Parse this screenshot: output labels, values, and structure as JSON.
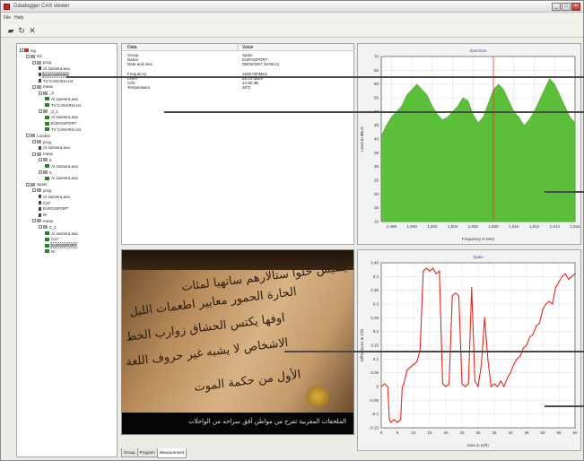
{
  "window": {
    "title": "Datalogger CAS viewer"
  },
  "menu": {
    "file": "File",
    "help": "Help"
  },
  "toolbar_icons": [
    "open-folder-icon",
    "refresh-icon",
    "close-x-icon"
  ],
  "tree": [
    {
      "label": "log",
      "depth": 0,
      "icon": "root"
    },
    {
      "label": "G1",
      "depth": 1,
      "icon": "folder"
    },
    {
      "label": "prog",
      "depth": 2,
      "icon": "folder"
    },
    {
      "label": "Al Jazeera.ava",
      "depth": 3,
      "icon": "doc"
    },
    {
      "label": "EUROSPORT",
      "depth": 3,
      "icon": "doc",
      "selected": true
    },
    {
      "label": "TV CANARIA.txt",
      "depth": 3,
      "icon": "doc"
    },
    {
      "label": "meas",
      "depth": 2,
      "icon": "folder"
    },
    {
      "label": "_0",
      "depth": 3,
      "icon": "folder"
    },
    {
      "label": "Al Jazeera.ava",
      "depth": 4,
      "icon": "meas"
    },
    {
      "label": "TV CANARIA.txt",
      "depth": 4,
      "icon": "meas"
    },
    {
      "label": "_0_1",
      "depth": 3,
      "icon": "folder"
    },
    {
      "label": "Al Jazeera.ava",
      "depth": 4,
      "icon": "meas"
    },
    {
      "label": "EUROSPORT",
      "depth": 4,
      "icon": "meas"
    },
    {
      "label": "TV CANARIA.txt",
      "depth": 4,
      "icon": "meas"
    },
    {
      "label": "London",
      "depth": 1,
      "icon": "folder"
    },
    {
      "label": "prog",
      "depth": 2,
      "icon": "folder"
    },
    {
      "label": "Al Jazeera.ava",
      "depth": 3,
      "icon": "doc"
    },
    {
      "label": "meas",
      "depth": 2,
      "icon": "folder"
    },
    {
      "label": "0",
      "depth": 3,
      "icon": "folder"
    },
    {
      "label": "Al Jazeera.ava",
      "depth": 4,
      "icon": "meas"
    },
    {
      "label": "0",
      "depth": 3,
      "icon": "folder"
    },
    {
      "label": "Al Jazeera.ava",
      "depth": 4,
      "icon": "meas"
    },
    {
      "label": "Spain",
      "depth": 1,
      "icon": "folder"
    },
    {
      "label": "prog",
      "depth": 2,
      "icon": "folder"
    },
    {
      "label": "Al Jazeera.ava",
      "depth": 3,
      "icon": "doc"
    },
    {
      "label": "C47",
      "depth": 3,
      "icon": "doc"
    },
    {
      "label": "EUROSPORT",
      "depth": 3,
      "icon": "doc"
    },
    {
      "label": "M",
      "depth": 3,
      "icon": "doc"
    },
    {
      "label": "meas",
      "depth": 2,
      "icon": "folder"
    },
    {
      "label": "0_1",
      "depth": 3,
      "icon": "folder"
    },
    {
      "label": "Al Jazeera.ava",
      "depth": 4,
      "icon": "meas"
    },
    {
      "label": "C47",
      "depth": 4,
      "icon": "meas"
    },
    {
      "label": "EUROSPORT",
      "depth": 4,
      "icon": "meas",
      "selected": true
    },
    {
      "label": "M",
      "depth": 4,
      "icon": "meas"
    }
  ],
  "properties": {
    "col_data": "Data",
    "col_value": "Value",
    "rows": [
      {
        "k": "Group",
        "v": "Spain"
      },
      {
        "k": "Name",
        "v": "EUROSPORT"
      },
      {
        "k": "Date and time",
        "v": "05/03/2007 16:08:21"
      },
      {
        "k": "",
        "v": ""
      },
      {
        "k": "Frequency",
        "v": "1508.000MHz"
      },
      {
        "k": "Level",
        "v": "55.00 dBuV"
      },
      {
        "k": "C/N",
        "v": "14.80 dB"
      },
      {
        "k": "Temperature",
        "v": "20ºC"
      }
    ]
  },
  "video": {
    "lines": [
      "يتقيس خلوا ستالارهم ساتهيا لمئات",
      "الحارة الحمور معايير اطعمات الليل",
      "اوفها يكتس الحشاق زوارب الخط",
      "الاشخاص لا يشبه غير حروف اللغة",
      "الأول من حكمة الموت"
    ],
    "caption": "الملحقات المغربية تفرح من مواطن أفق سراحه من الواحلات"
  },
  "tabs": [
    "Group",
    "Program",
    "Measurement"
  ],
  "active_tab": "Measurement",
  "colors": {
    "spectrum_fill": "#5cbf3a",
    "time_series": "#e8271e",
    "marker": "#e8271e",
    "grid": "#9ea7b0"
  },
  "chart_data": [
    {
      "type": "area",
      "title": "Spectrum",
      "xlabel": "Frequency in MHz",
      "ylabel": "Level in dBuV",
      "xlim": [
        1497,
        1516
      ],
      "ylim": [
        10,
        70
      ],
      "x_ticks": [
        1,
        498,
        1,
        500,
        1,
        502,
        1,
        504,
        1,
        506,
        1,
        508,
        1,
        510,
        1,
        512,
        1,
        514,
        1,
        516
      ],
      "x_tick_labels": [
        "1,498",
        "1,500",
        "1,502",
        "1,504",
        "1,506",
        "1,508",
        "1,510",
        "1,512",
        "1,514",
        "1,516"
      ],
      "y_ticks": [
        10,
        15,
        20,
        25,
        30,
        35,
        40,
        45,
        50,
        55,
        60,
        65,
        70
      ],
      "marker_x": 1508,
      "x": [
        1497.0,
        1497.5,
        1498.0,
        1498.5,
        1499.0,
        1499.5,
        1500.0,
        1500.5,
        1501.0,
        1501.5,
        1502.0,
        1502.5,
        1503.0,
        1503.5,
        1504.0,
        1504.5,
        1505.0,
        1505.5,
        1506.0,
        1506.5,
        1507.0,
        1507.5,
        1508.0,
        1508.5,
        1509.0,
        1509.5,
        1510.0,
        1510.5,
        1511.0,
        1511.5,
        1512.0,
        1512.5,
        1513.0,
        1513.5,
        1514.0,
        1514.5,
        1515.0,
        1515.5,
        1516.0
      ],
      "values": [
        41,
        45,
        48,
        50,
        52,
        56,
        58,
        60,
        58,
        56,
        52,
        49,
        47,
        48,
        50,
        52,
        55,
        54,
        49,
        46,
        48,
        53,
        58,
        60,
        58,
        54,
        50,
        48,
        45,
        47,
        50,
        54,
        58,
        62,
        60,
        56,
        52,
        48,
        46
      ]
    },
    {
      "type": "line",
      "title": "Spain",
      "xlabel": "time in (s/h)",
      "ylabel": "Differences in C/N",
      "xlim": [
        0,
        60
      ],
      "ylim": [
        -0.15,
        0.45
      ],
      "x_ticks": [
        0,
        5,
        10,
        15,
        20,
        25,
        30,
        35,
        40,
        45,
        50,
        55,
        60
      ],
      "y_ticks": [
        -0.15,
        -0.1,
        -0.05,
        0,
        0.05,
        0.1,
        0.15,
        0.2,
        0.25,
        0.3,
        0.35,
        0.4,
        0.45
      ],
      "y_tick_labels": [
        "-0.15",
        "-0.1",
        "-0.05",
        "0",
        "0.05",
        "0.1",
        "0.15",
        "0.2",
        "0.25",
        "0.3",
        "0.35",
        "0.4",
        "0.45"
      ],
      "x": [
        0,
        1,
        2,
        2.5,
        3,
        4,
        5,
        6,
        6.5,
        7,
        8,
        9,
        10,
        11,
        12,
        13,
        14,
        15,
        16,
        17,
        18,
        19,
        20,
        21,
        22,
        23,
        24,
        25,
        26,
        27,
        28,
        29,
        30,
        31,
        32,
        33,
        34,
        35,
        36,
        37,
        38,
        39,
        40,
        41,
        42,
        43,
        44,
        45,
        46,
        47,
        48,
        49,
        50,
        51,
        52,
        53,
        54,
        55,
        56,
        57,
        58,
        59,
        60
      ],
      "values": [
        0.0,
        0.01,
        0.0,
        -0.12,
        -0.13,
        -0.12,
        -0.13,
        -0.12,
        0.0,
        0.01,
        0.06,
        0.07,
        0.08,
        0.09,
        0.13,
        0.42,
        0.43,
        0.42,
        0.43,
        0.41,
        0.42,
        0.01,
        0.0,
        0.01,
        0.33,
        0.34,
        0.33,
        0.01,
        0.0,
        0.01,
        0.36,
        0.02,
        0.0,
        0.08,
        0.25,
        0.1,
        0.0,
        0.01,
        0.0,
        0.02,
        0.0,
        0.03,
        0.05,
        0.08,
        0.1,
        0.11,
        0.14,
        0.15,
        0.18,
        0.19,
        0.22,
        0.23,
        0.28,
        0.3,
        0.31,
        0.3,
        0.36,
        0.38,
        0.4,
        0.41,
        0.39,
        0.4,
        0.41
      ]
    }
  ]
}
